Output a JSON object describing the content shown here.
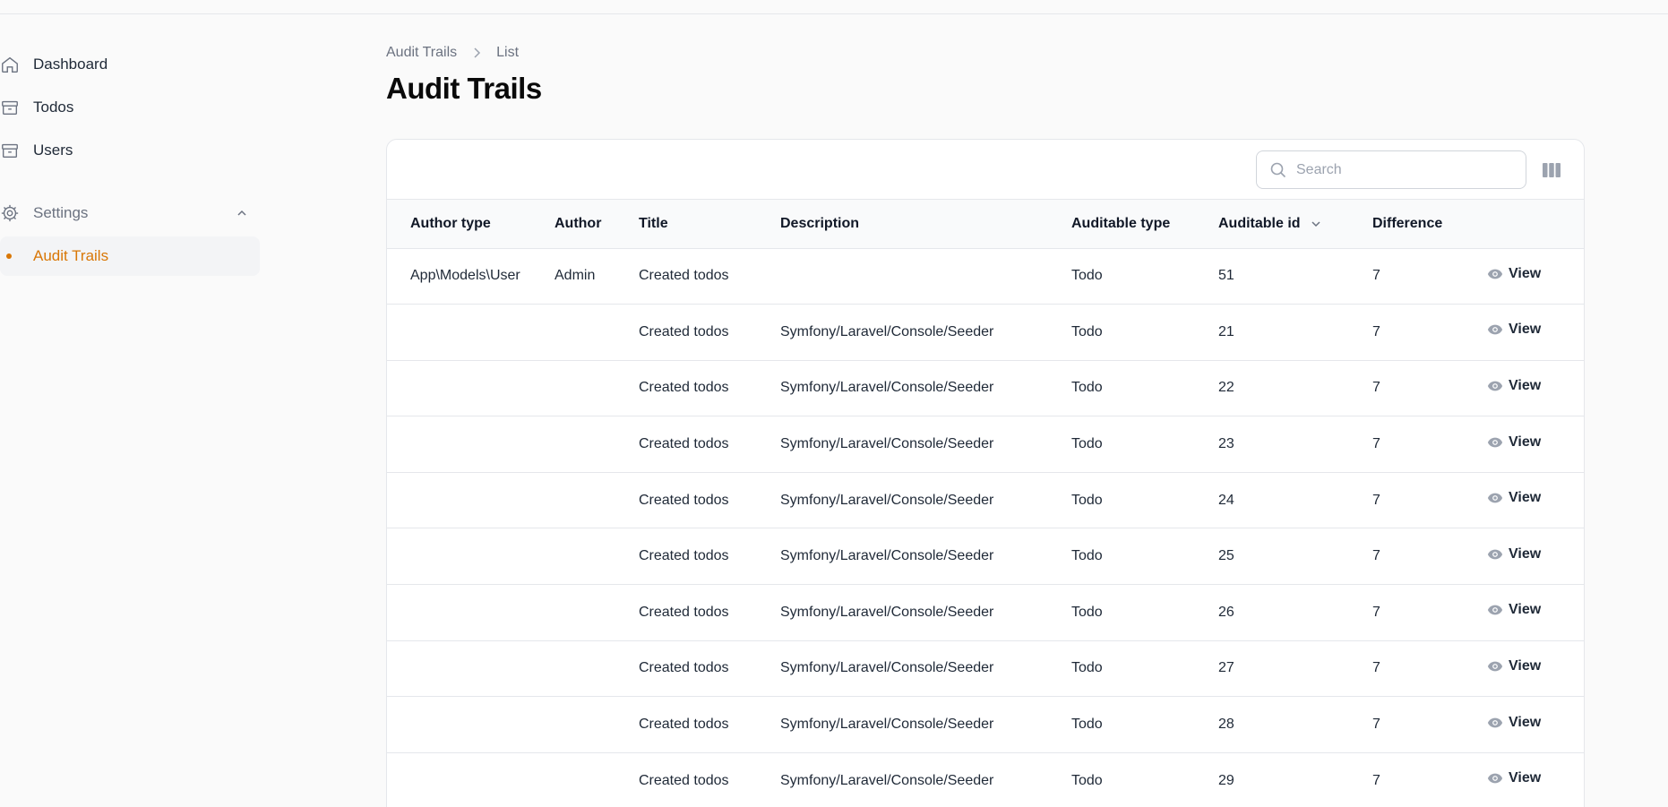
{
  "sidebar": {
    "items": [
      {
        "label": "Dashboard",
        "icon": "home-icon"
      },
      {
        "label": "Todos",
        "icon": "archive-icon"
      },
      {
        "label": "Users",
        "icon": "archive-icon"
      }
    ],
    "group": {
      "label": "Settings",
      "icon": "cog-icon",
      "expanded": true
    },
    "active_item": {
      "label": "Audit Trails"
    }
  },
  "breadcrumb": {
    "first": "Audit Trails",
    "second": "List"
  },
  "page": {
    "title": "Audit Trails"
  },
  "search": {
    "placeholder": "Search",
    "value": ""
  },
  "table": {
    "columns": [
      "Author type",
      "Author",
      "Title",
      "Description",
      "Auditable type",
      "Auditable id",
      "Difference"
    ],
    "sorted_column": "Auditable id",
    "action_label": "View",
    "rows": [
      {
        "author_type": "App\\Models\\User",
        "author": "Admin",
        "title": "Created todos",
        "description": "",
        "auditable_type": "Todo",
        "auditable_id": "51",
        "difference": "7"
      },
      {
        "author_type": "",
        "author": "",
        "title": "Created todos",
        "description": "Symfony/Laravel/Console/Seeder",
        "auditable_type": "Todo",
        "auditable_id": "21",
        "difference": "7"
      },
      {
        "author_type": "",
        "author": "",
        "title": "Created todos",
        "description": "Symfony/Laravel/Console/Seeder",
        "auditable_type": "Todo",
        "auditable_id": "22",
        "difference": "7"
      },
      {
        "author_type": "",
        "author": "",
        "title": "Created todos",
        "description": "Symfony/Laravel/Console/Seeder",
        "auditable_type": "Todo",
        "auditable_id": "23",
        "difference": "7"
      },
      {
        "author_type": "",
        "author": "",
        "title": "Created todos",
        "description": "Symfony/Laravel/Console/Seeder",
        "auditable_type": "Todo",
        "auditable_id": "24",
        "difference": "7"
      },
      {
        "author_type": "",
        "author": "",
        "title": "Created todos",
        "description": "Symfony/Laravel/Console/Seeder",
        "auditable_type": "Todo",
        "auditable_id": "25",
        "difference": "7"
      },
      {
        "author_type": "",
        "author": "",
        "title": "Created todos",
        "description": "Symfony/Laravel/Console/Seeder",
        "auditable_type": "Todo",
        "auditable_id": "26",
        "difference": "7"
      },
      {
        "author_type": "",
        "author": "",
        "title": "Created todos",
        "description": "Symfony/Laravel/Console/Seeder",
        "auditable_type": "Todo",
        "auditable_id": "27",
        "difference": "7"
      },
      {
        "author_type": "",
        "author": "",
        "title": "Created todos",
        "description": "Symfony/Laravel/Console/Seeder",
        "auditable_type": "Todo",
        "auditable_id": "28",
        "difference": "7"
      },
      {
        "author_type": "",
        "author": "",
        "title": "Created todos",
        "description": "Symfony/Laravel/Console/Seeder",
        "auditable_type": "Todo",
        "auditable_id": "29",
        "difference": "7"
      }
    ]
  },
  "colors": {
    "accent": "#d97706",
    "muted": "#6b7280",
    "border": "#e5e7eb"
  }
}
